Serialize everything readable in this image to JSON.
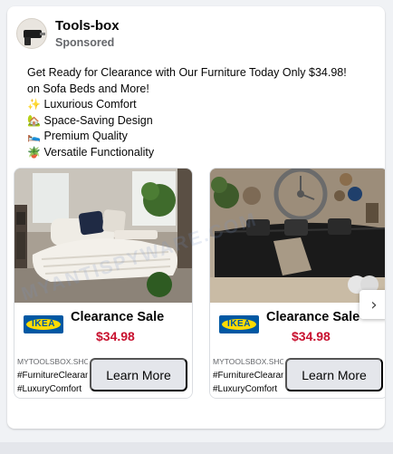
{
  "post": {
    "page_name": "Tools-box",
    "sponsored": "Sponsored",
    "text_line1": "Get Ready for Clearance with Our Furniture Today Only $34.98!",
    "text_line2": "on Sofa Beds and More!",
    "features": [
      {
        "icon": "sparkles-icon",
        "emoji": "✨",
        "label": "Luxurious Comfort"
      },
      {
        "icon": "house-icon",
        "emoji": "🏡",
        "label": "Space-Saving Design"
      },
      {
        "icon": "bed-icon",
        "emoji": "🛌",
        "label": "Premium Quality"
      },
      {
        "icon": "potted-plant-icon",
        "emoji": "🪴",
        "label": "Versatile Functionality"
      }
    ]
  },
  "carousel": {
    "cards": [
      {
        "brand": "IKEA",
        "title": "Clearance Sale",
        "price": "$34.98",
        "domain": "MYTOOLSBOX.SHOP",
        "hashtag1": "#FurnitureClearance",
        "hashtag2": "#LuxuryComfort",
        "cta": "Learn More"
      },
      {
        "brand": "IKEA",
        "title": "Clearance Sale",
        "price": "$34.98",
        "domain": "MYTOOLSBOX.SHOP",
        "hashtag1": "#FurnitureClearance",
        "hashtag2": "#LuxuryComfort",
        "cta": "Learn More"
      }
    ],
    "next_icon": "chevron-right-icon",
    "next_glyph": "›"
  },
  "watermark": "MYANTISPYWARE.COM",
  "colors": {
    "price": "#c8102e",
    "ikea_blue": "#0058a3",
    "ikea_yellow": "#ffdb00",
    "button_bg": "#e4e6eb"
  }
}
